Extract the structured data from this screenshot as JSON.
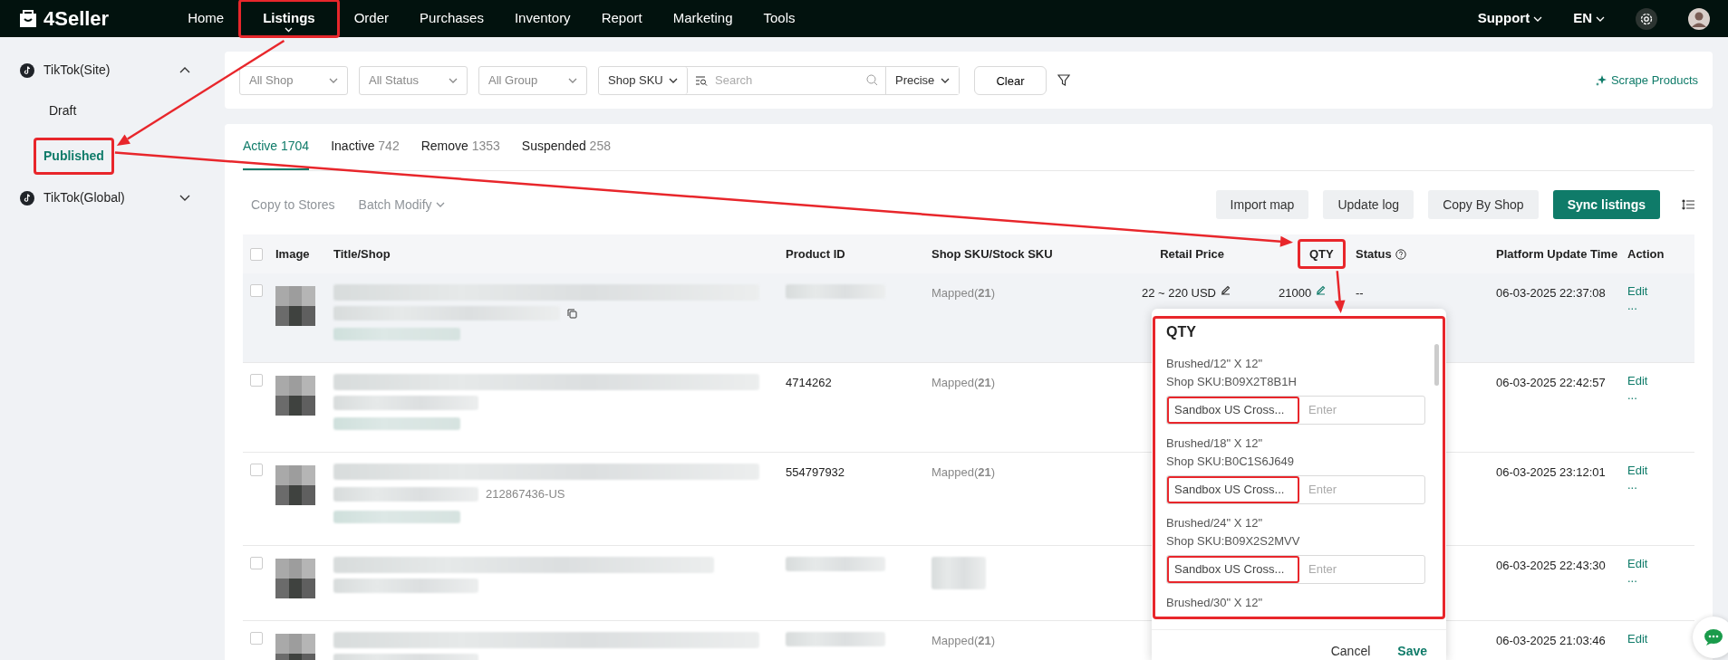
{
  "brand": "4Seller",
  "nav": [
    {
      "label": "Home",
      "selected": false,
      "highlighted": false
    },
    {
      "label": "Listings",
      "selected": true,
      "highlighted": true
    },
    {
      "label": "Order",
      "selected": false,
      "highlighted": false
    },
    {
      "label": "Purchases",
      "selected": false,
      "highlighted": false
    },
    {
      "label": "Inventory",
      "selected": false,
      "highlighted": false
    },
    {
      "label": "Report",
      "selected": false,
      "highlighted": false
    },
    {
      "label": "Marketing",
      "selected": false,
      "highlighted": false
    },
    {
      "label": "Tools",
      "selected": false,
      "highlighted": false
    }
  ],
  "nav_right": [
    {
      "label": "Support"
    },
    {
      "label": "EN"
    }
  ],
  "sidebar": [
    {
      "label": "TikTok(Site)",
      "expanded": true,
      "children": [
        {
          "label": "Draft",
          "selected": false,
          "highlighted": false
        },
        {
          "label": "Published",
          "selected": true,
          "highlighted": true
        }
      ]
    },
    {
      "label": "TikTok(Global)",
      "expanded": false
    }
  ],
  "filters": {
    "selects": [
      "All Shop",
      "All Status",
      "All Group"
    ],
    "search_type": "Shop SKU",
    "search": {
      "placeholder": "Search"
    },
    "match": "Precise",
    "clear": "Clear",
    "scrape": "Scrape Products"
  },
  "tabs": [
    {
      "label": "Active",
      "count": "1704",
      "selected": true
    },
    {
      "label": "Inactive",
      "count": "742",
      "selected": false
    },
    {
      "label": "Remove",
      "count": "1353",
      "selected": false
    },
    {
      "label": "Suspended",
      "count": "258",
      "selected": false
    }
  ],
  "toolbar": {
    "left": [
      {
        "label": "Copy to Stores",
        "disabled": true,
        "dropdown": false
      },
      {
        "label": "Batch Modify",
        "disabled": true,
        "dropdown": true
      }
    ],
    "right": [
      {
        "label": "Import map",
        "kind": "secondary"
      },
      {
        "label": "Update log",
        "kind": "secondary"
      },
      {
        "label": "Copy By Shop",
        "kind": "secondary"
      },
      {
        "label": "Sync listings",
        "kind": "primary"
      }
    ]
  },
  "table": {
    "checked": false,
    "columns": [
      {
        "label": "Image",
        "highlighted": false
      },
      {
        "label": "Title/Shop",
        "highlighted": false
      },
      {
        "label": "Product ID",
        "highlighted": false
      },
      {
        "label": "Shop SKU/Stock SKU",
        "highlighted": false
      },
      {
        "label": "Retail Price",
        "highlighted": false
      },
      {
        "label": "QTY",
        "highlighted": true
      },
      {
        "label": "Status",
        "highlighted": false,
        "help": true
      },
      {
        "label": "Platform Update Time",
        "highlighted": false
      },
      {
        "label": "Action",
        "highlighted": false
      }
    ],
    "rows": [
      {
        "hovered": true,
        "checked": false,
        "sku": "Mapped(**21**)",
        "price": "22 ~ 220 USD",
        "qty": "21000",
        "status": "--",
        "time": "06-03-2025 22:37:08",
        "actions": [
          "Edit",
          "..."
        ]
      },
      {
        "hovered": false,
        "checked": false,
        "product_id": "4714262",
        "sku": "Mapped(**21**)",
        "time": "06-03-2025 22:42:57",
        "actions": [
          "Edit",
          "..."
        ]
      },
      {
        "hovered": false,
        "checked": false,
        "shop_note": "212867436-US",
        "product_id": "554797932",
        "sku": "Mapped(**21**)",
        "time": "06-03-2025 23:12:01",
        "actions": [
          "Edit",
          "..."
        ]
      },
      {
        "hovered": false,
        "checked": false,
        "time": "06-03-2025 22:43:30",
        "actions": [
          "Edit",
          "..."
        ]
      },
      {
        "hovered": false,
        "checked": false,
        "sku": "Mapped(**21**)",
        "time": "06-03-2025 21:03:46",
        "actions": [
          "Edit"
        ]
      }
    ]
  },
  "qty_popup": {
    "title": "QTY",
    "highlighted": true,
    "items": [
      {
        "variant": "Brushed/12\" X 12\"",
        "sku": "Shop SKU:B09X2T8B1H",
        "store": "Sandbox US Cross...",
        "placeholder": "Enter",
        "highlighted": true
      },
      {
        "variant": "Brushed/18\" X 12\"",
        "sku": "Shop SKU:B0C1S6J649",
        "store": "Sandbox US Cross...",
        "placeholder": "Enter",
        "highlighted": true
      },
      {
        "variant": "Brushed/24\" X 12\"",
        "sku": "Shop SKU:B09X2S2MVV",
        "store": "Sandbox US Cross...",
        "placeholder": "Enter",
        "highlighted": true
      },
      {
        "variant": "Brushed/30\" X 12\""
      }
    ],
    "cancel": "Cancel",
    "save": "Save"
  },
  "annotation_arrows": true
}
